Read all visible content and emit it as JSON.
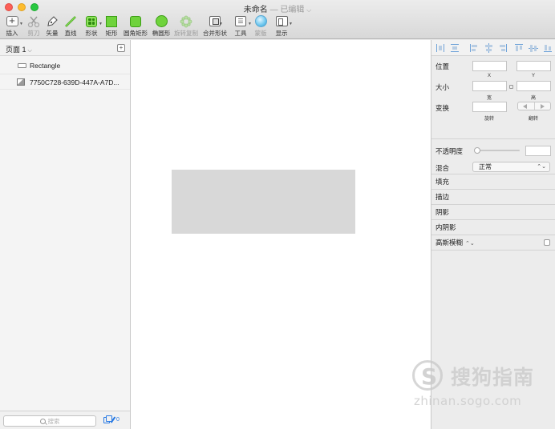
{
  "window": {
    "title": "未命名",
    "separator": "—",
    "status": "已编辑",
    "status_chevron": "⌵"
  },
  "toolbar": {
    "items": [
      {
        "label": "插入",
        "icon": "insert-icon",
        "dim": false
      },
      {
        "label": "剪刀",
        "icon": "scissors-icon",
        "dim": true
      },
      {
        "label": "矢量",
        "icon": "vector-pen-icon",
        "dim": false
      },
      {
        "label": "直线",
        "icon": "line-icon",
        "dim": false
      },
      {
        "label": "形状",
        "icon": "shape-icon",
        "dim": false
      },
      {
        "label": "矩形",
        "icon": "rectangle-icon",
        "dim": false
      },
      {
        "label": "圆角矩形",
        "icon": "rounded-rectangle-icon",
        "dim": false
      },
      {
        "label": "椭圆形",
        "icon": "oval-icon",
        "dim": false
      },
      {
        "label": "旋转复制",
        "icon": "rotate-copy-icon",
        "dim": true
      },
      {
        "label": "合并形状",
        "icon": "combine-shapes-icon",
        "dim": false
      },
      {
        "label": "工具",
        "icon": "tools-icon",
        "dim": false
      },
      {
        "label": "蒙版",
        "icon": "mask-icon",
        "dim": true
      },
      {
        "label": "显示",
        "icon": "view-icon",
        "dim": false
      }
    ]
  },
  "left_panel": {
    "page_selector": "页面 1",
    "page_chevron": "⌵",
    "add_page_symbol": "+",
    "layers": [
      {
        "label": "Rectangle",
        "icon": "rectangle-layer-icon"
      },
      {
        "label": "7750C728-639D-447A-A7D...",
        "icon": "image-layer-icon"
      }
    ],
    "search_placeholder": "搜索",
    "footer_count": "0"
  },
  "inspector": {
    "position_label": "位置",
    "x_label": "X",
    "y_label": "Y",
    "size_label": "大小",
    "width_label": "宽",
    "height_label": "高",
    "transform_label": "变换",
    "rotate_label": "旋转",
    "flip_label": "翻转",
    "opacity_label": "不透明度",
    "opacity_level": 0,
    "blend_label": "混合",
    "blend_value": "正常",
    "sections": [
      "填充",
      "描边",
      "阴影",
      "内阴影"
    ],
    "blur_label": "高斯模糊",
    "updown_symbol": "⌃⌄"
  },
  "watermark": {
    "text": "搜狗指南",
    "url": "zhinan.sogo.com"
  },
  "colors": {
    "shape_fill": "#d8d8d8",
    "tool_green": "#6fd33c",
    "accent_blue": "#2a7be4"
  }
}
